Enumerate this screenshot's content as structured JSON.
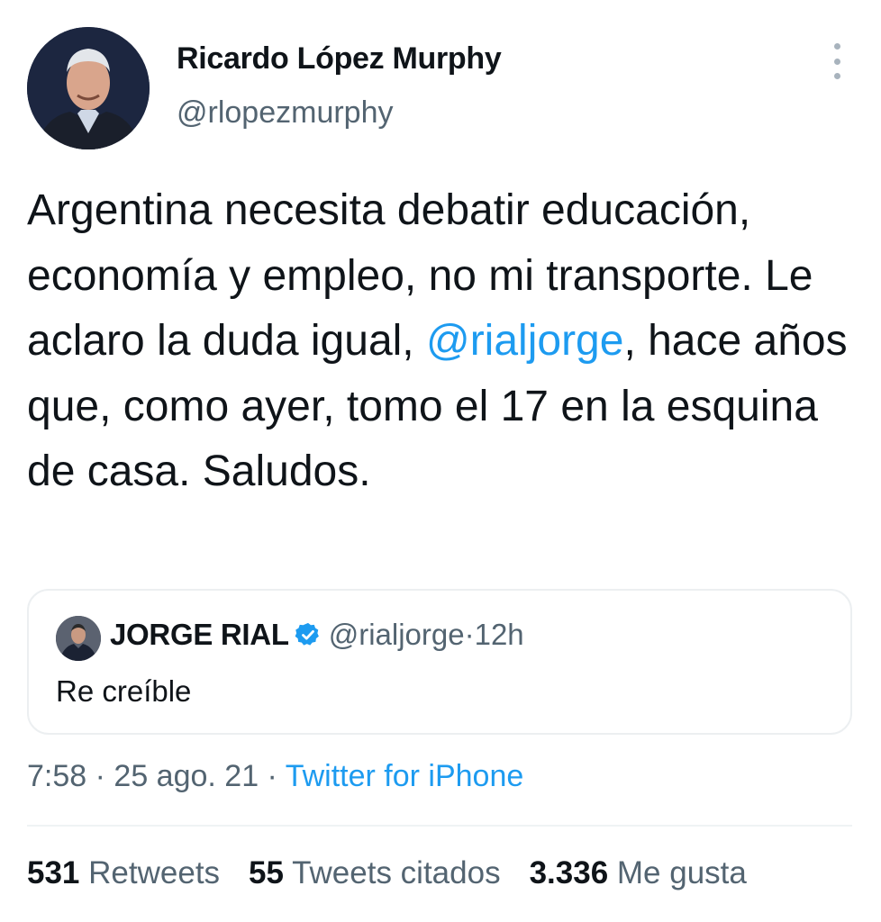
{
  "author": {
    "display_name": "Ricardo López Murphy",
    "handle": "@rlopezmurphy",
    "avatar_icon": "profile-photo"
  },
  "tweet": {
    "text_before": "Argentina necesita debatir educación, economía y empleo, no mi transporte. Le aclaro la duda igual, ",
    "mention": "@rialjorge",
    "text_after": ", hace años que, como ayer, tomo el 17 en la esquina de casa. Saludos."
  },
  "quoted_tweet": {
    "display_name": "JORGE RIAL",
    "verified_icon": "verified-badge-icon",
    "handle": "@rialjorge",
    "separator": " · ",
    "time": "12h",
    "text": "Re creíble"
  },
  "meta": {
    "time": "7:58",
    "separator1": " · ",
    "date": "25 ago. 21",
    "separator2": " · ",
    "source": "Twitter for iPhone"
  },
  "stats": {
    "retweets_count": "531",
    "retweets_label": "Retweets",
    "quotes_count": "55",
    "quotes_label": "Tweets citados",
    "likes_count": "3.336",
    "likes_label": "Me gusta"
  },
  "colors": {
    "link": "#1d9bf0",
    "secondary_text": "#536471",
    "primary_text": "#0f1419",
    "border": "#eff3f4"
  }
}
